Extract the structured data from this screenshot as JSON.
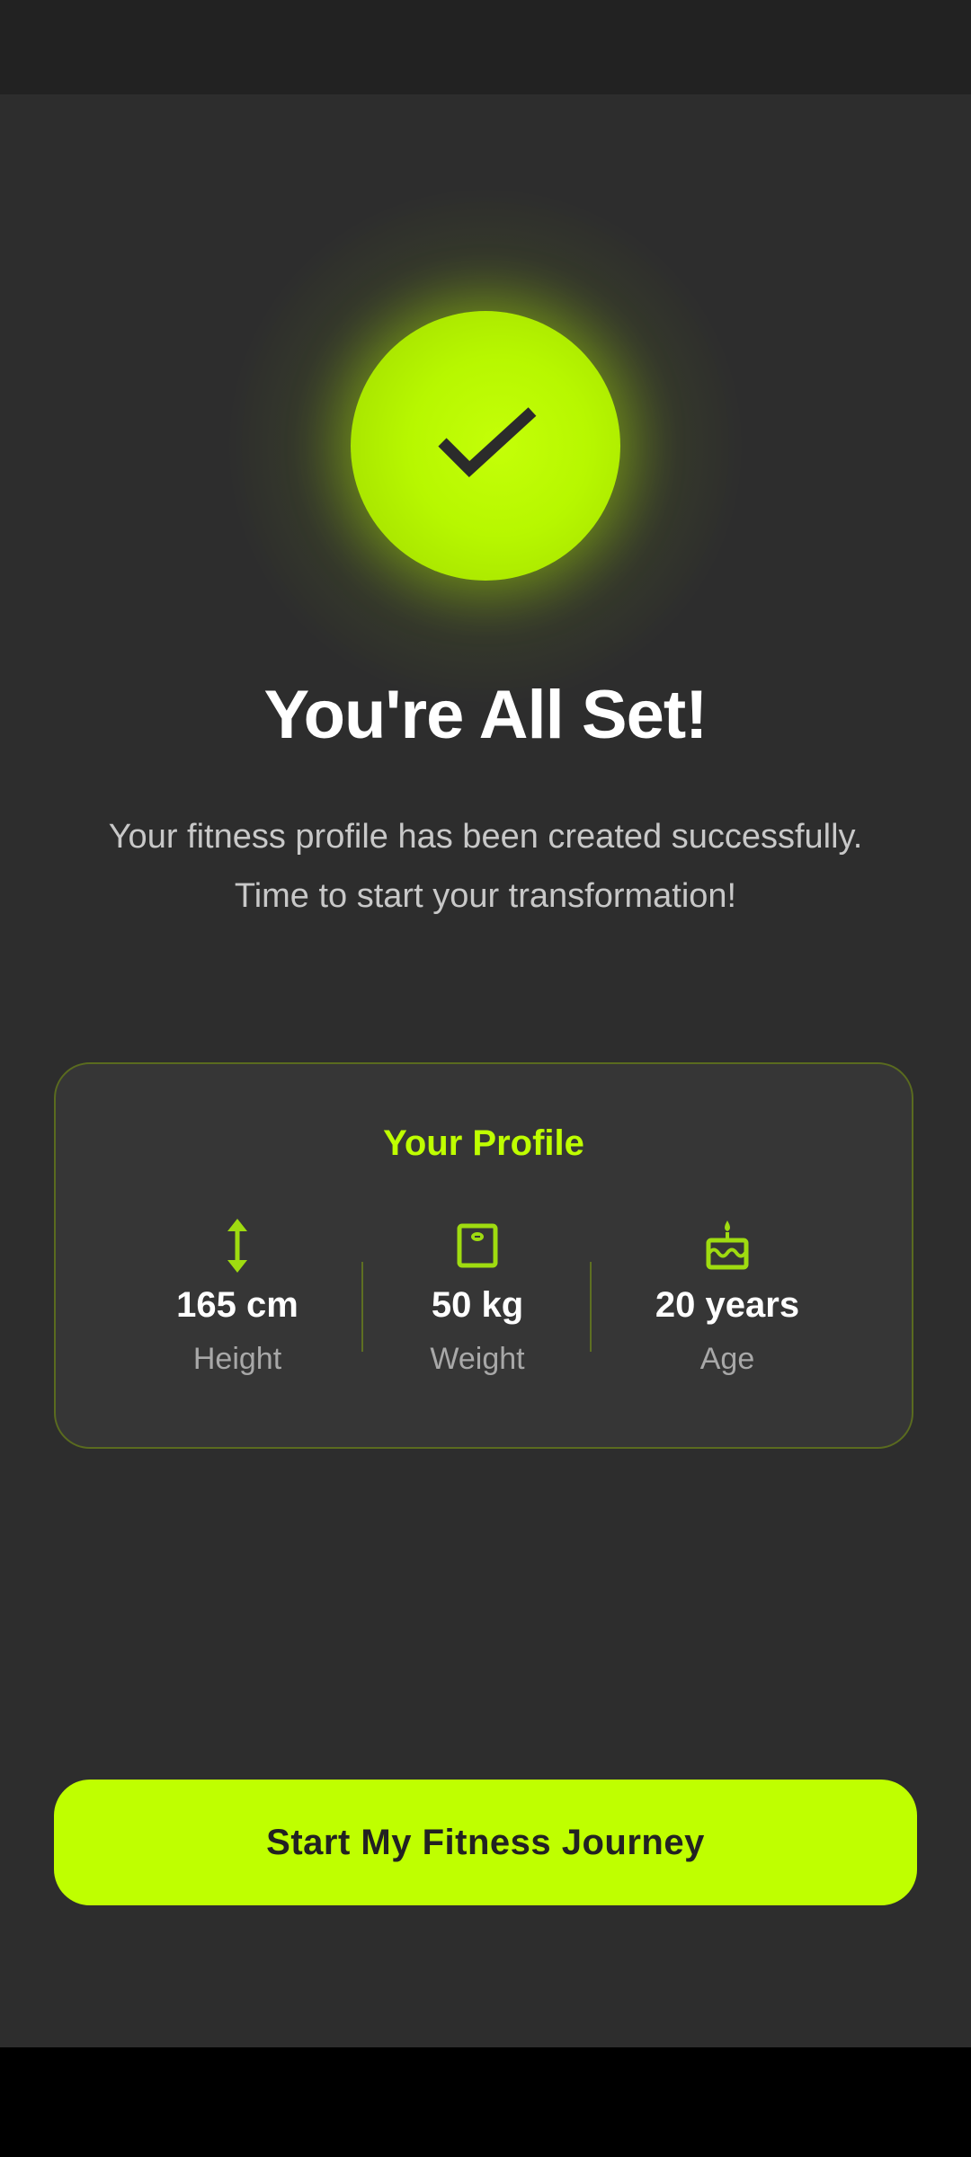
{
  "header": {
    "title": "You're All Set!",
    "subtitle_line1": "Your fitness profile has been created successfully.",
    "subtitle_line2": "Time to start your transformation!"
  },
  "success_icon": "checkmark-icon",
  "profile": {
    "title": "Your Profile",
    "stats": [
      {
        "icon": "height-arrows-icon",
        "value": "165 cm",
        "label": "Height"
      },
      {
        "icon": "weight-scale-icon",
        "value": "50 kg",
        "label": "Weight"
      },
      {
        "icon": "birthday-cake-icon",
        "value": "20 years",
        "label": "Age"
      }
    ]
  },
  "cta": {
    "label": "Start My Fitness Journey"
  },
  "colors": {
    "accent": "#bfff00",
    "background": "#2d2d2d",
    "card": "#363636",
    "card_border": "#5a6b1f"
  }
}
